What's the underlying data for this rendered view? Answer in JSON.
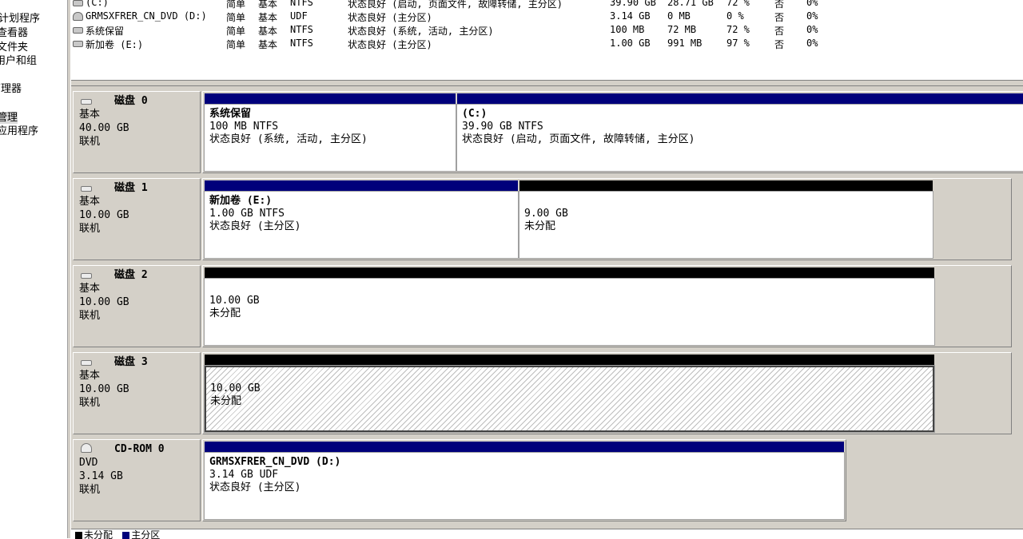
{
  "left_tree": {
    "items": [
      "计划程序",
      "查看器",
      "文件夹",
      "用户和组",
      "管理器",
      "管理",
      "应用程序"
    ],
    "selected_index": 5
  },
  "volume_list": {
    "rows": [
      {
        "icon": "disk-volume-icon",
        "name": "(C:)",
        "layout": "简单",
        "type": "基本",
        "fs": "NTFS",
        "status": "状态良好 (启动, 页面文件, 故障转储, 主分区)",
        "capacity": "39.90 GB",
        "free": "28.71 GB",
        "pct_free": "72 %",
        "fault_tolerance": "否",
        "overhead": "0%"
      },
      {
        "icon": "cd-volume-icon",
        "name": "GRMSXFRER_CN_DVD (D:)",
        "layout": "简单",
        "type": "基本",
        "fs": "UDF",
        "status": "状态良好 (主分区)",
        "capacity": "3.14 GB",
        "free": "0 MB",
        "pct_free": "0 %",
        "fault_tolerance": "否",
        "overhead": "0%"
      },
      {
        "icon": "disk-volume-icon",
        "name": "系统保留",
        "layout": "简单",
        "type": "基本",
        "fs": "NTFS",
        "status": "状态良好 (系统, 活动, 主分区)",
        "capacity": "100 MB",
        "free": "72 MB",
        "pct_free": "72 %",
        "fault_tolerance": "否",
        "overhead": "0%"
      },
      {
        "icon": "disk-volume-icon",
        "name": "新加卷 (E:)",
        "layout": "简单",
        "type": "基本",
        "fs": "NTFS",
        "status": "状态良好 (主分区)",
        "capacity": "1.00 GB",
        "free": "991 MB",
        "pct_free": "97 %",
        "fault_tolerance": "否",
        "overhead": "0%"
      }
    ]
  },
  "disks": [
    {
      "title": "磁盘 0",
      "kind": "基本",
      "size": "40.00 GB",
      "state": "联机",
      "icon": "hard-disk-icon",
      "partitions": [
        {
          "name": "系统保留",
          "detail": "100 MB NTFS",
          "status": "状态良好 (系统, 活动, 主分区)",
          "bar": "primary"
        },
        {
          "name": "(C:)",
          "detail": "39.90 GB NTFS",
          "status": "状态良好 (启动, 页面文件, 故障转储, 主分区)",
          "bar": "primary"
        }
      ]
    },
    {
      "title": "磁盘 1",
      "kind": "基本",
      "size": "10.00 GB",
      "state": "联机",
      "icon": "hard-disk-icon",
      "partitions": [
        {
          "name": "新加卷 (E:)",
          "detail": "1.00 GB NTFS",
          "status": "状态良好 (主分区)",
          "bar": "primary"
        },
        {
          "name": "",
          "detail": "9.00 GB",
          "status": "未分配",
          "bar": "unallocated"
        }
      ]
    },
    {
      "title": "磁盘 2",
      "kind": "基本",
      "size": "10.00 GB",
      "state": "联机",
      "icon": "hard-disk-icon",
      "partitions": [
        {
          "name": "",
          "detail": "10.00 GB",
          "status": "未分配",
          "bar": "unallocated"
        }
      ]
    },
    {
      "title": "磁盘 3",
      "kind": "基本",
      "size": "10.00 GB",
      "state": "联机",
      "icon": "hard-disk-icon",
      "partitions": [
        {
          "name": "",
          "detail": "10.00 GB",
          "status": "未分配",
          "bar": "unallocated",
          "selected": true
        }
      ]
    },
    {
      "title": "CD-ROM 0",
      "kind": "DVD",
      "size": "3.14 GB",
      "state": "联机",
      "icon": "cd-rom-icon",
      "partitions": [
        {
          "name": "GRMSXFRER_CN_DVD (D:)",
          "detail": "3.14 GB UDF",
          "status": "状态良好 (主分区)",
          "bar": "primary"
        }
      ]
    }
  ],
  "legend": {
    "items": [
      {
        "label": "未分配",
        "color": "#000000"
      },
      {
        "label": "主分区",
        "color": "#00007b"
      }
    ]
  },
  "colors": {
    "primary_partition": "#00007b",
    "unallocated": "#000000",
    "panel": "#d4d0c8"
  }
}
